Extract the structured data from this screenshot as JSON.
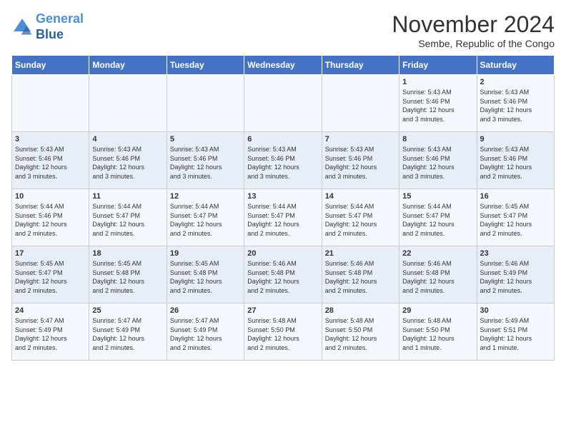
{
  "logo": {
    "line1": "General",
    "line2": "Blue"
  },
  "title": "November 2024",
  "subtitle": "Sembe, Republic of the Congo",
  "days_of_week": [
    "Sunday",
    "Monday",
    "Tuesday",
    "Wednesday",
    "Thursday",
    "Friday",
    "Saturday"
  ],
  "weeks": [
    [
      {
        "day": "",
        "info": ""
      },
      {
        "day": "",
        "info": ""
      },
      {
        "day": "",
        "info": ""
      },
      {
        "day": "",
        "info": ""
      },
      {
        "day": "",
        "info": ""
      },
      {
        "day": "1",
        "info": "Sunrise: 5:43 AM\nSunset: 5:46 PM\nDaylight: 12 hours\nand 3 minutes."
      },
      {
        "day": "2",
        "info": "Sunrise: 5:43 AM\nSunset: 5:46 PM\nDaylight: 12 hours\nand 3 minutes."
      }
    ],
    [
      {
        "day": "3",
        "info": "Sunrise: 5:43 AM\nSunset: 5:46 PM\nDaylight: 12 hours\nand 3 minutes."
      },
      {
        "day": "4",
        "info": "Sunrise: 5:43 AM\nSunset: 5:46 PM\nDaylight: 12 hours\nand 3 minutes."
      },
      {
        "day": "5",
        "info": "Sunrise: 5:43 AM\nSunset: 5:46 PM\nDaylight: 12 hours\nand 3 minutes."
      },
      {
        "day": "6",
        "info": "Sunrise: 5:43 AM\nSunset: 5:46 PM\nDaylight: 12 hours\nand 3 minutes."
      },
      {
        "day": "7",
        "info": "Sunrise: 5:43 AM\nSunset: 5:46 PM\nDaylight: 12 hours\nand 3 minutes."
      },
      {
        "day": "8",
        "info": "Sunrise: 5:43 AM\nSunset: 5:46 PM\nDaylight: 12 hours\nand 3 minutes."
      },
      {
        "day": "9",
        "info": "Sunrise: 5:43 AM\nSunset: 5:46 PM\nDaylight: 12 hours\nand 2 minutes."
      }
    ],
    [
      {
        "day": "10",
        "info": "Sunrise: 5:44 AM\nSunset: 5:46 PM\nDaylight: 12 hours\nand 2 minutes."
      },
      {
        "day": "11",
        "info": "Sunrise: 5:44 AM\nSunset: 5:47 PM\nDaylight: 12 hours\nand 2 minutes."
      },
      {
        "day": "12",
        "info": "Sunrise: 5:44 AM\nSunset: 5:47 PM\nDaylight: 12 hours\nand 2 minutes."
      },
      {
        "day": "13",
        "info": "Sunrise: 5:44 AM\nSunset: 5:47 PM\nDaylight: 12 hours\nand 2 minutes."
      },
      {
        "day": "14",
        "info": "Sunrise: 5:44 AM\nSunset: 5:47 PM\nDaylight: 12 hours\nand 2 minutes."
      },
      {
        "day": "15",
        "info": "Sunrise: 5:44 AM\nSunset: 5:47 PM\nDaylight: 12 hours\nand 2 minutes."
      },
      {
        "day": "16",
        "info": "Sunrise: 5:45 AM\nSunset: 5:47 PM\nDaylight: 12 hours\nand 2 minutes."
      }
    ],
    [
      {
        "day": "17",
        "info": "Sunrise: 5:45 AM\nSunset: 5:47 PM\nDaylight: 12 hours\nand 2 minutes."
      },
      {
        "day": "18",
        "info": "Sunrise: 5:45 AM\nSunset: 5:48 PM\nDaylight: 12 hours\nand 2 minutes."
      },
      {
        "day": "19",
        "info": "Sunrise: 5:45 AM\nSunset: 5:48 PM\nDaylight: 12 hours\nand 2 minutes."
      },
      {
        "day": "20",
        "info": "Sunrise: 5:46 AM\nSunset: 5:48 PM\nDaylight: 12 hours\nand 2 minutes."
      },
      {
        "day": "21",
        "info": "Sunrise: 5:46 AM\nSunset: 5:48 PM\nDaylight: 12 hours\nand 2 minutes."
      },
      {
        "day": "22",
        "info": "Sunrise: 5:46 AM\nSunset: 5:48 PM\nDaylight: 12 hours\nand 2 minutes."
      },
      {
        "day": "23",
        "info": "Sunrise: 5:46 AM\nSunset: 5:49 PM\nDaylight: 12 hours\nand 2 minutes."
      }
    ],
    [
      {
        "day": "24",
        "info": "Sunrise: 5:47 AM\nSunset: 5:49 PM\nDaylight: 12 hours\nand 2 minutes."
      },
      {
        "day": "25",
        "info": "Sunrise: 5:47 AM\nSunset: 5:49 PM\nDaylight: 12 hours\nand 2 minutes."
      },
      {
        "day": "26",
        "info": "Sunrise: 5:47 AM\nSunset: 5:49 PM\nDaylight: 12 hours\nand 2 minutes."
      },
      {
        "day": "27",
        "info": "Sunrise: 5:48 AM\nSunset: 5:50 PM\nDaylight: 12 hours\nand 2 minutes."
      },
      {
        "day": "28",
        "info": "Sunrise: 5:48 AM\nSunset: 5:50 PM\nDaylight: 12 hours\nand 2 minutes."
      },
      {
        "day": "29",
        "info": "Sunrise: 5:48 AM\nSunset: 5:50 PM\nDaylight: 12 hours\nand 1 minute."
      },
      {
        "day": "30",
        "info": "Sunrise: 5:49 AM\nSunset: 5:51 PM\nDaylight: 12 hours\nand 1 minute."
      }
    ]
  ]
}
